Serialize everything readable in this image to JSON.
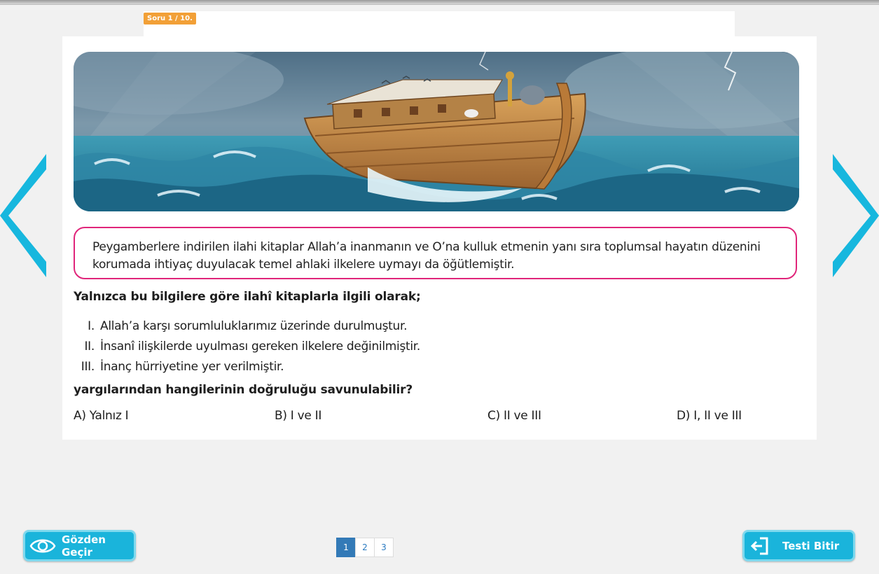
{
  "header": {
    "question_counter": "Soru 1 / 10."
  },
  "question": {
    "info_text": "Peygamberlere indirilen ilahi kitaplar Allah’a inanmanın ve O’na kulluk etmenin yanı sıra toplumsal hayatın düzenini korumada ihtiyaç duyulacak temel ahlaki ilkelere uymayı da öğütlemiştir.",
    "stem": "Yalnızca bu bilgilere göre ilahî kitaplarla ilgili olarak;",
    "items": [
      {
        "num": "I.",
        "text": "Allah’a karşı sorumluluklarımız üzerinde durulmuştur."
      },
      {
        "num": "II.",
        "text": "İnsanî ilişkilerde uyulması gereken ilkelere değinilmiştir."
      },
      {
        "num": "III.",
        "text": "İnanç hürriyetine yer verilmiştir."
      }
    ],
    "prompt": "yargılarından hangilerinin doğruluğu savunulabilir?",
    "options": [
      {
        "label": "A)  Yalnız I"
      },
      {
        "label": "B) I ve II"
      },
      {
        "label": "C) II ve III"
      },
      {
        "label": "D) I, II ve III"
      }
    ]
  },
  "footer": {
    "review_label": "Gözden Geçir",
    "finish_label": "Testi Bitir",
    "pages": [
      "1",
      "2",
      "3"
    ],
    "active_page": "1"
  },
  "colors": {
    "accent": "#1ab4db",
    "box_border": "#e0257a",
    "badge": "#f2a037",
    "pager_active": "#337ab7"
  },
  "icons": [
    "chevron-left-icon",
    "chevron-right-icon",
    "eye-icon",
    "exit-icon"
  ]
}
